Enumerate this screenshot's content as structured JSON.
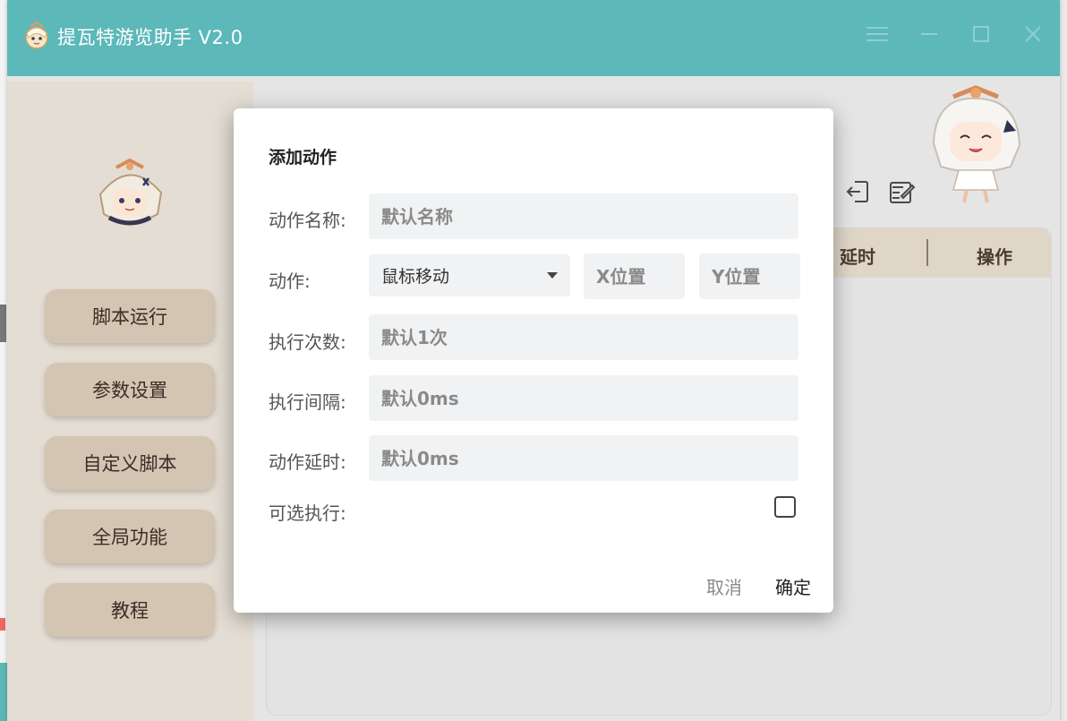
{
  "window": {
    "title": "提瓦特游览助手 V2.0",
    "accent_color": "#5db8b9",
    "controls": [
      "menu-icon",
      "minimize-icon",
      "maximize-icon",
      "close-icon"
    ]
  },
  "sidebar": {
    "items": [
      {
        "label": "脚本运行"
      },
      {
        "label": "参数设置"
      },
      {
        "label": "自定义脚本"
      },
      {
        "label": "全局功能"
      },
      {
        "label": "教程"
      }
    ]
  },
  "main": {
    "toolbar_icons": [
      "import-icon",
      "edit-export-icon"
    ],
    "table_headers": [
      "延时",
      "操作"
    ]
  },
  "dialog": {
    "title": "添加动作",
    "fields": {
      "name": {
        "label": "动作名称:",
        "placeholder": "默认名称"
      },
      "action": {
        "label": "动作:",
        "selected": "鼠标移动",
        "x_placeholder": "X位置",
        "y_placeholder": "Y位置"
      },
      "count": {
        "label": "执行次数:",
        "placeholder": "默认1次"
      },
      "interval": {
        "label": "执行间隔:",
        "placeholder": "默认0ms"
      },
      "delay": {
        "label": "动作延时:",
        "placeholder": "默认0ms"
      },
      "optional": {
        "label": "可选执行:",
        "checked": false
      }
    },
    "cancel_label": "取消",
    "confirm_label": "确定"
  }
}
